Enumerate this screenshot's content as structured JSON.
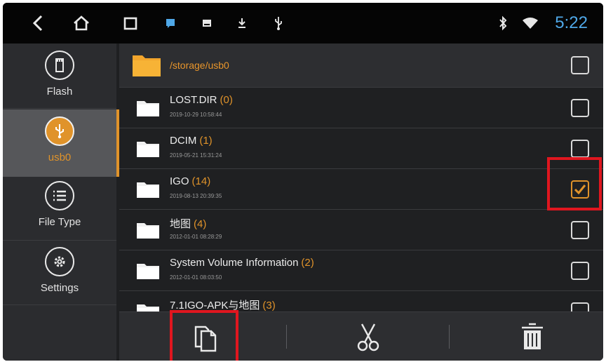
{
  "status_bar": {
    "time": "5:22",
    "icons": [
      "back-icon",
      "home-icon",
      "recent-apps-icon",
      "notification-icon",
      "gallery-icon",
      "download-icon",
      "usb-icon",
      "bluetooth-icon",
      "wifi-icon"
    ]
  },
  "sidebar": {
    "items": [
      {
        "label": "Flash",
        "icon": "flash-storage-icon",
        "active": false
      },
      {
        "label": "usb0",
        "icon": "usb-icon",
        "active": true
      },
      {
        "label": "File Type",
        "icon": "list-icon",
        "active": false
      },
      {
        "label": "Settings",
        "icon": "gear-icon",
        "active": false
      }
    ]
  },
  "file_list": {
    "path": "/storage/usb0",
    "rows": [
      {
        "name": "LOST.DIR",
        "count": "(0)",
        "date": "2019-10-29 10:58:44",
        "checked": false
      },
      {
        "name": "DCIM",
        "count": "(1)",
        "date": "2019-05-21 15:31:24",
        "checked": false
      },
      {
        "name": "IGO",
        "count": "(14)",
        "date": "2019-08-13 20:39:35",
        "checked": true
      },
      {
        "name": "地图",
        "count": "(4)",
        "date": "2012-01-01 08:28:29",
        "checked": false
      },
      {
        "name": "System Volume Information",
        "count": "(2)",
        "date": "2012-01-01 08:03:50",
        "checked": false
      },
      {
        "name": "7.1IGO-APK与地图",
        "count": "(3)",
        "date": "",
        "checked": false
      }
    ]
  },
  "toolbar": {
    "actions": [
      "copy-icon",
      "cut-icon",
      "delete-icon"
    ]
  },
  "colors": {
    "accent": "#e0932a",
    "time": "#4fa8e8",
    "highlight_box": "#e0161f"
  }
}
